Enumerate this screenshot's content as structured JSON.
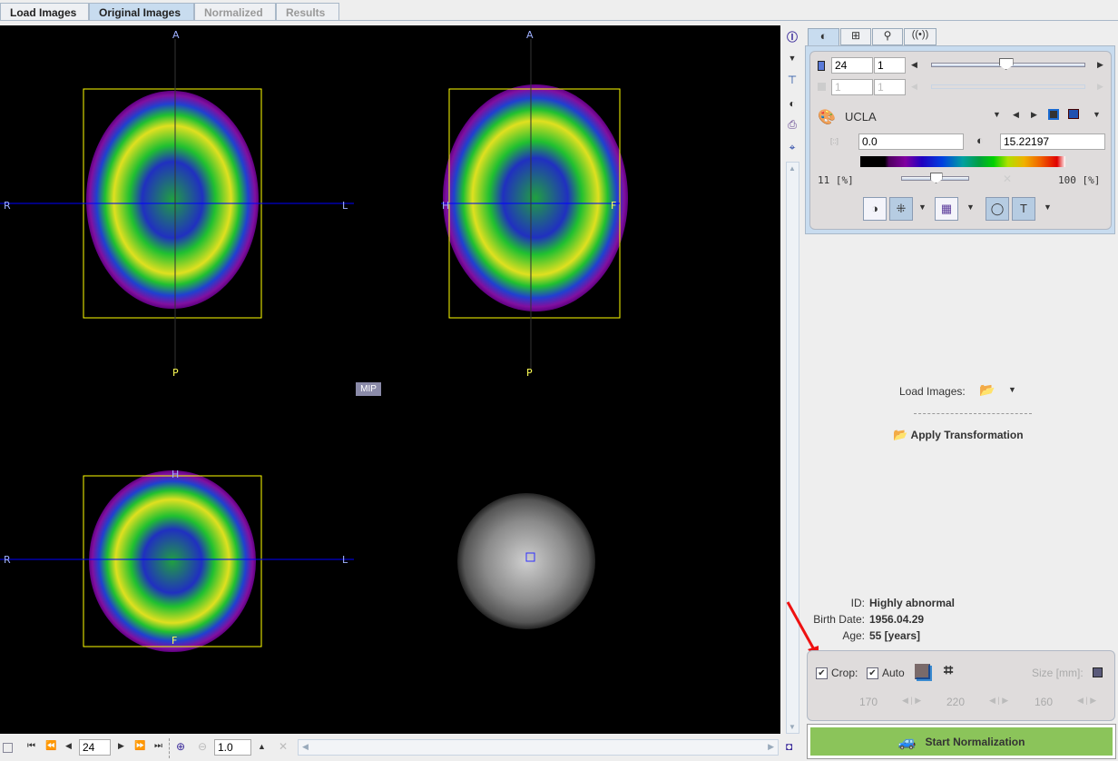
{
  "tabs": [
    {
      "label": "Load Images",
      "state": "normal"
    },
    {
      "label": "Original Images",
      "state": "selected"
    },
    {
      "label": "Normalized",
      "state": "disabled"
    },
    {
      "label": "Results",
      "state": "disabled"
    }
  ],
  "viewer": {
    "axial": {
      "top": "A",
      "bottom": "P",
      "left": "R",
      "right": "L"
    },
    "sagittal": {
      "top": "A",
      "bottom": "P",
      "left": "H",
      "right": "F"
    },
    "coronal": {
      "top": "H",
      "bottom": "F",
      "left": "R",
      "right": "L"
    },
    "mip_label": "MIP"
  },
  "side_tools": [
    "info-icon",
    "dropdown-icon",
    "network-icon",
    "contrast-icon",
    "print-icon",
    "crosshair-icon"
  ],
  "ctrl_tabs": [
    "contrast-icon",
    "layout-icon",
    "fusion-icon",
    "signal-icon"
  ],
  "slice": {
    "plane": "24",
    "frame": "1",
    "plane2": "1",
    "frame2": "1",
    "slider_fraction": 0.48
  },
  "colormap": {
    "name": "UCLA",
    "min": "0.0",
    "max": "15.22197",
    "lower_pct": "11",
    "upper_pct": "100",
    "unit": "[%]",
    "threshold_slider_fraction": 0.5
  },
  "load": {
    "label": "Load Images:",
    "apply": "Apply Transformation"
  },
  "patient": {
    "id_label": "ID:",
    "id": "Highly abnormal",
    "birth_label": "Birth Date:",
    "birth": "1956.04.29",
    "age_label": "Age:",
    "age": "55 [years]"
  },
  "crop": {
    "crop_label": "Crop:",
    "crop_checked": true,
    "auto_label": "Auto",
    "auto_checked": true,
    "size_label": "Size [mm]:",
    "x": "170",
    "y": "220",
    "z": "160"
  },
  "start_button": "Start Normalization",
  "bottom": {
    "slice": "24",
    "zoom": "1.0"
  },
  "colors": {
    "accent_green": "#8bc45a",
    "crosshair": "#0000ff",
    "box": "#ffff00",
    "selected_tab": "#c8dcef"
  }
}
